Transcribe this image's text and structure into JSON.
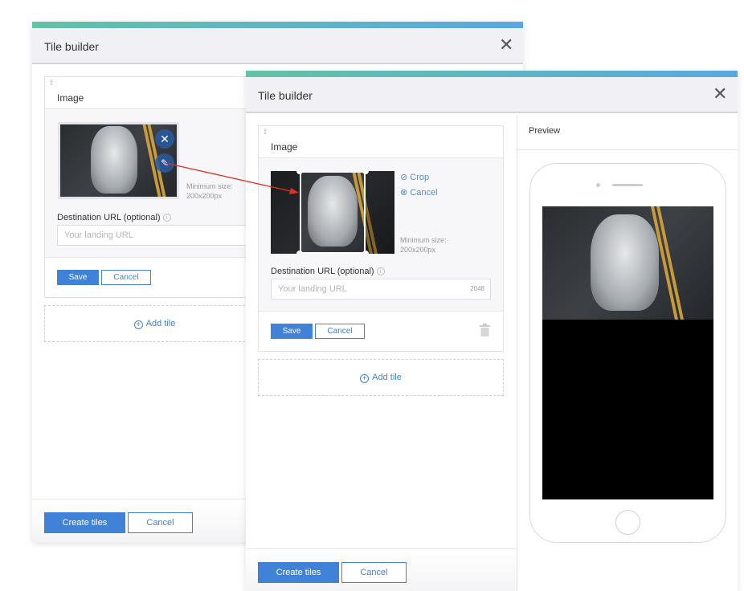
{
  "back_window": {
    "title": "Tile builder",
    "card": {
      "title": "Image",
      "min_size_label": "Minimum size:",
      "min_size_value": "200x200px",
      "destination_label": "Destination URL (optional)",
      "url_placeholder": "Your landing URL",
      "save": "Save",
      "cancel": "Cancel"
    },
    "add_tile": "Add tile",
    "create_tiles": "Create tiles",
    "cancel": "Cancel"
  },
  "front_window": {
    "title": "Tile builder",
    "card": {
      "title": "Image",
      "crop": "Crop",
      "crop_cancel": "Cancel",
      "min_size_label": "Minimum size:",
      "min_size_value": "200x200px",
      "destination_label": "Destination URL (optional)",
      "url_placeholder": "Your landing URL",
      "char_limit": "2048",
      "save": "Save",
      "cancel": "Cancel"
    },
    "add_tile": "Add tile",
    "create_tiles": "Create tiles",
    "cancel": "Cancel",
    "preview_title": "Preview"
  },
  "colors": {
    "accent": "#3f82d8",
    "gradient_start": "#62c3a6",
    "gradient_end": "#5aa8e0",
    "arrow": "#e0301e"
  }
}
